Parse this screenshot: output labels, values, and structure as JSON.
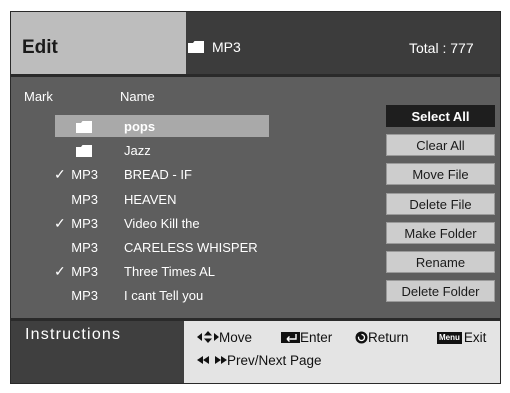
{
  "header": {
    "title": "Edit",
    "folder_name": "MP3",
    "total": "Total : 777"
  },
  "columns": {
    "mark": "Mark",
    "name": "Name"
  },
  "rows": [
    {
      "checked": false,
      "check": "",
      "type": "",
      "icon": "folder-icon",
      "name": "pops",
      "selected": true
    },
    {
      "checked": false,
      "check": "",
      "type": "",
      "icon": "folder-icon",
      "name": "Jazz",
      "selected": false
    },
    {
      "checked": true,
      "check": "✓",
      "type": "MP3",
      "icon": "",
      "name": "BREAD - IF",
      "selected": false
    },
    {
      "checked": false,
      "check": "",
      "type": "MP3",
      "icon": "",
      "name": "HEAVEN",
      "selected": false
    },
    {
      "checked": true,
      "check": "✓",
      "type": "MP3",
      "icon": "",
      "name": "Video Kill the",
      "selected": false
    },
    {
      "checked": false,
      "check": "",
      "type": "MP3",
      "icon": "",
      "name": "CARELESS WHISPER",
      "selected": false
    },
    {
      "checked": true,
      "check": "✓",
      "type": "MP3",
      "icon": "",
      "name": "Three Times AL",
      "selected": false
    },
    {
      "checked": false,
      "check": "",
      "type": "MP3",
      "icon": "",
      "name": "I cant Tell you",
      "selected": false
    }
  ],
  "buttons": [
    {
      "label": "Select All",
      "active": true
    },
    {
      "label": "Clear All",
      "active": false
    },
    {
      "label": "Move File",
      "active": false
    },
    {
      "label": "Delete File",
      "active": false
    },
    {
      "label": "Make Folder",
      "active": false
    },
    {
      "label": "Rename",
      "active": false
    },
    {
      "label": "Delete Folder",
      "active": false
    }
  ],
  "footer": {
    "instructions": "Instructions",
    "move": "Move",
    "enter": "Enter",
    "return": "Return",
    "menu": "Menu",
    "exit": "Exit",
    "prev_next": "Prev/Next Page"
  },
  "colors": {
    "panel_bg": "#5e5e5e",
    "header_left": "#bdbdbd",
    "header_right": "#3c3c3c",
    "highlight": "#a9a9a9",
    "active_button": "#1e1e1e",
    "button": "#cdcdcd"
  }
}
